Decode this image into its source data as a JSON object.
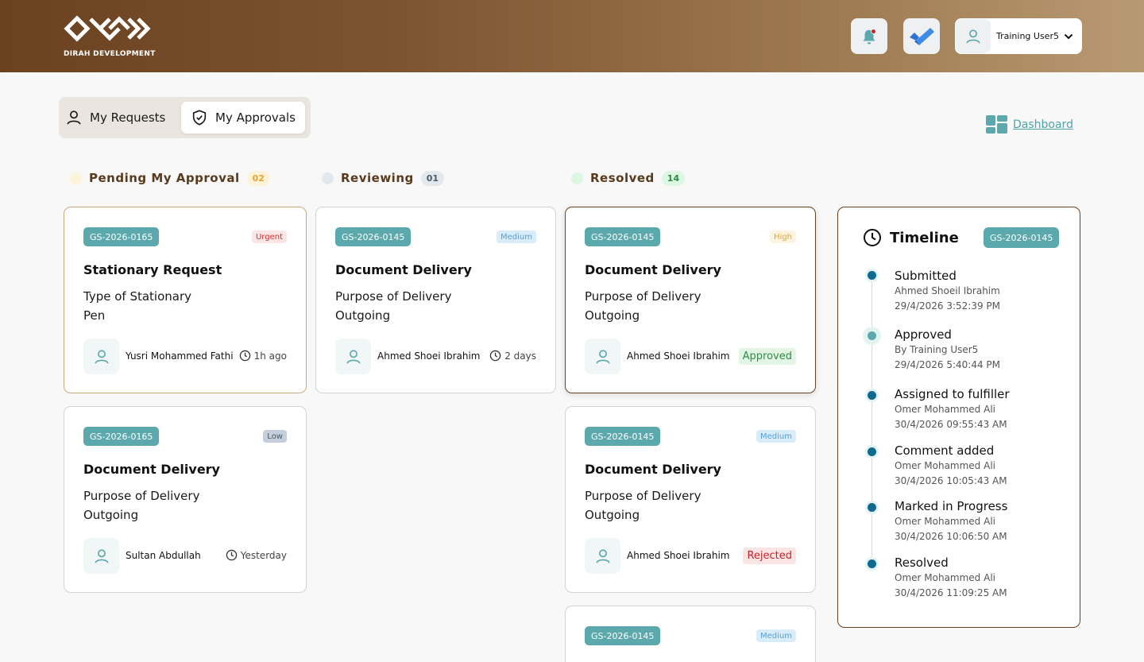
{
  "brand": {
    "name": "DIRAH DEVELOPMENT"
  },
  "header": {
    "bell_icon": "bell-icon",
    "todo_icon": "todo-check-icon",
    "user_name": "Training User5"
  },
  "tabs": [
    {
      "label": "My Requests",
      "icon": "user-icon",
      "active": false
    },
    {
      "label": "My Approvals",
      "icon": "shield-check-icon",
      "active": true
    }
  ],
  "dashboard": {
    "label": "Dashboard",
    "icon": "dashboard-grid-icon"
  },
  "columns": [
    {
      "label": "Pending My Approval",
      "count": "02",
      "dot_color": "#fdf3d8",
      "badge_bg": "#fdf3d8",
      "badge_color": "#e5a531"
    },
    {
      "label": "Reviewing",
      "count": "01",
      "dot_color": "#e3e8ee",
      "badge_bg": "#e3e8ee",
      "badge_color": "#4a5b6c"
    },
    {
      "label": "Resolved",
      "count": "14",
      "dot_color": "#dcf7e2",
      "badge_bg": "#dcf7e2",
      "badge_color": "#2f8b44"
    }
  ],
  "cards": {
    "c1": {
      "id": "GS-2026-0165",
      "priority": "Urgent",
      "title": "Stationary Request",
      "line1": "Type of Stationary",
      "line2": "Pen",
      "person": "Yusri Mohammed Fathi",
      "time": "1h ago"
    },
    "c2": {
      "id": "GS-2026-0165",
      "priority": "Low",
      "title": "Document Delivery",
      "line1": "Purpose of Delivery",
      "line2": "Outgoing",
      "person": "Sultan Abdullah",
      "time": "Yesterday"
    },
    "c3": {
      "id": "GS-2026-0145",
      "priority": "Medium",
      "title": "Document Delivery",
      "line1": "Purpose of Delivery",
      "line2": "Outgoing",
      "person": "Ahmed Shoei Ibrahim",
      "time": "2 days"
    },
    "c4": {
      "id": "GS-2026-0145",
      "priority": "High",
      "title": "Document Delivery",
      "line1": "Purpose of Delivery",
      "line2": "Outgoing",
      "person": "Ahmed Shoei Ibrahim",
      "status": "Approved"
    },
    "c5": {
      "id": "GS-2026-0145",
      "priority": "Medium",
      "title": "Document Delivery",
      "line1": "Purpose of Delivery",
      "line2": "Outgoing",
      "person": "Ahmed Shoei Ibrahim",
      "status": "Rejected"
    },
    "c6": {
      "id": "GS-2026-0145",
      "priority": "Medium"
    }
  },
  "timeline": {
    "title": "Timeline",
    "request_id": "GS-2026-0145",
    "events": [
      {
        "title": "Submitted",
        "by": "Ahmed Shoeil Ibrahim",
        "time": "29/4/2026 3:52:39 PM"
      },
      {
        "title": "Approved",
        "by": "By Training User5",
        "time": "29/4/2026 5:40:44 PM"
      },
      {
        "title": "Assigned to fulfiller",
        "by": "Omer Mohammed Ali",
        "time": "30/4/2026 09:55:43 AM"
      },
      {
        "title": "Comment added",
        "by": "Omer Mohammed Ali",
        "time": "30/4/2026 10:05:43 AM"
      },
      {
        "title": "Marked in Progress",
        "by": "Omer Mohammed Ali",
        "time": "30/4/2026 10:06:50 AM"
      },
      {
        "title": "Resolved",
        "by": "Omer Mohammed Ali",
        "time": "30/4/2026 11:09:25 AM"
      }
    ]
  },
  "colors": {
    "accent": "#5ba9ad",
    "brand_brown": "#6b4220",
    "link": "#4ea3a8"
  }
}
